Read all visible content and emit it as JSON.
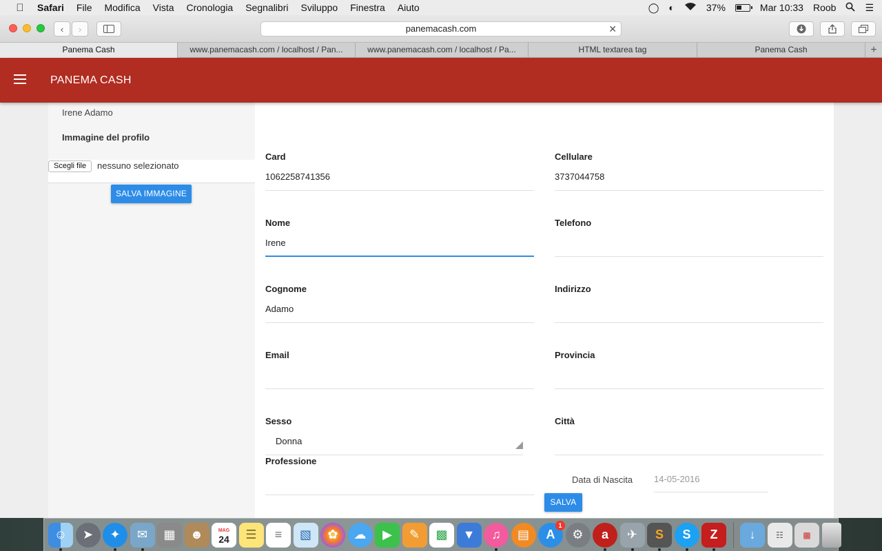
{
  "menubar": {
    "app": "Safari",
    "items": [
      "File",
      "Modifica",
      "Vista",
      "Cronologia",
      "Segnalibri",
      "Sviluppo",
      "Finestra",
      "Aiuto"
    ],
    "battery": "37%",
    "clock": "Mar 10:33",
    "user": "Roob"
  },
  "browser": {
    "url": "panemacash.com",
    "tabs": [
      {
        "label": "Panema Cash"
      },
      {
        "label": "www.panemacash.com / localhost / Pan..."
      },
      {
        "label": "www.panemacash.com / localhost / Pa..."
      },
      {
        "label": "HTML textarea tag"
      },
      {
        "label": "Panema Cash"
      }
    ]
  },
  "appbar": {
    "title": "PANEMA CASH"
  },
  "sidebar": {
    "user_name": "Irene Adamo",
    "image_label": "Immagine del profilo",
    "file_button": "Scegli file",
    "file_status": "nessuno selezionato",
    "save_image": "SALVA IMMAGINE"
  },
  "form": {
    "card": {
      "label": "Card",
      "value": "1062258741356"
    },
    "cellulare": {
      "label": "Cellulare",
      "value": "3737044758"
    },
    "nome": {
      "label": "Nome",
      "value": "Irene"
    },
    "telefono": {
      "label": "Telefono",
      "value": ""
    },
    "cognome": {
      "label": "Cognome",
      "value": "Adamo"
    },
    "indirizzo": {
      "label": "Indirizzo",
      "value": ""
    },
    "email": {
      "label": "Email",
      "value": ""
    },
    "provincia": {
      "label": "Provincia",
      "value": ""
    },
    "sesso": {
      "label": "Sesso",
      "value": "Donna"
    },
    "citta": {
      "label": "Città",
      "value": ""
    },
    "professione": {
      "label": "Professione",
      "value": ""
    },
    "data_nascita": {
      "label": "Data di Nascita",
      "value": "14-05-2016"
    },
    "save": "SALVA"
  },
  "dock": {
    "calendar_month": "MAG",
    "calendar_day": "24",
    "appstore_badge": "1"
  },
  "colors": {
    "appbar": "#b12c21",
    "accent": "#2d8ce8"
  }
}
